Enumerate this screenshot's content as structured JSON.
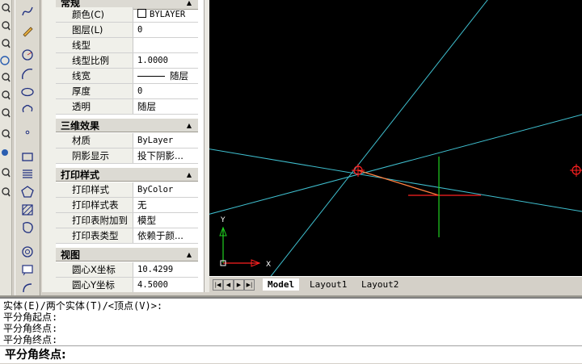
{
  "properties": {
    "sections": {
      "general": {
        "title": "常规"
      },
      "effects3d": {
        "title": "三维效果"
      },
      "plotstyle": {
        "title": "打印样式"
      },
      "view": {
        "title": "视图"
      }
    },
    "general_rows": [
      {
        "label": "颜色(C)",
        "value": "BYLAYER"
      },
      {
        "label": "图层(L)",
        "value": "0"
      },
      {
        "label": "线型",
        "value": ""
      },
      {
        "label": "线型比例",
        "value": "1.0000"
      },
      {
        "label": "线宽",
        "value": "随层"
      },
      {
        "label": "厚度",
        "value": "0"
      },
      {
        "label": "透明",
        "value": "随层"
      }
    ],
    "effects_rows": [
      {
        "label": "材质",
        "value": "ByLayer"
      },
      {
        "label": "阴影显示",
        "value": "投下阴影..."
      }
    ],
    "plot_rows": [
      {
        "label": "打印样式",
        "value": "ByColor"
      },
      {
        "label": "打印样式表",
        "value": "无"
      },
      {
        "label": "打印表附加到",
        "value": "模型"
      },
      {
        "label": "打印表类型",
        "value": "依赖于颜..."
      }
    ],
    "view_rows": [
      {
        "label": "圆心X坐标",
        "value": "10.4299"
      },
      {
        "label": "圆心Y坐标",
        "value": "4.5000"
      }
    ]
  },
  "canvas": {
    "background": "#000000",
    "ucs": {
      "x_label": "X",
      "y_label": "Y"
    }
  },
  "tabs": {
    "model": "Model",
    "layout1": "Layout1",
    "layout2": "Layout2"
  },
  "command": {
    "history": [
      "实体(E)/两个实体(T)/<顶点(V)>:",
      "平分角起点:",
      "平分角终点:",
      "平分角终点:"
    ],
    "prompt": "平分角终点:"
  },
  "icons": {
    "toolbar": [
      "spline-icon",
      "pencil-icon",
      "circle-center-icon",
      "arc-icon",
      "ellipse-icon",
      "revcloud-icon",
      "point-icon",
      "rectangle-icon",
      "helix-icon",
      "polygon-icon",
      "hatch-icon",
      "region-icon",
      "donut-icon",
      "text-icon",
      "wipeout-icon"
    ]
  },
  "colors": {
    "xline": "#3fbfcf",
    "crosshair_red": "#ff2020",
    "crosshair_green": "#20d020",
    "selected_line": "#ff8040"
  }
}
